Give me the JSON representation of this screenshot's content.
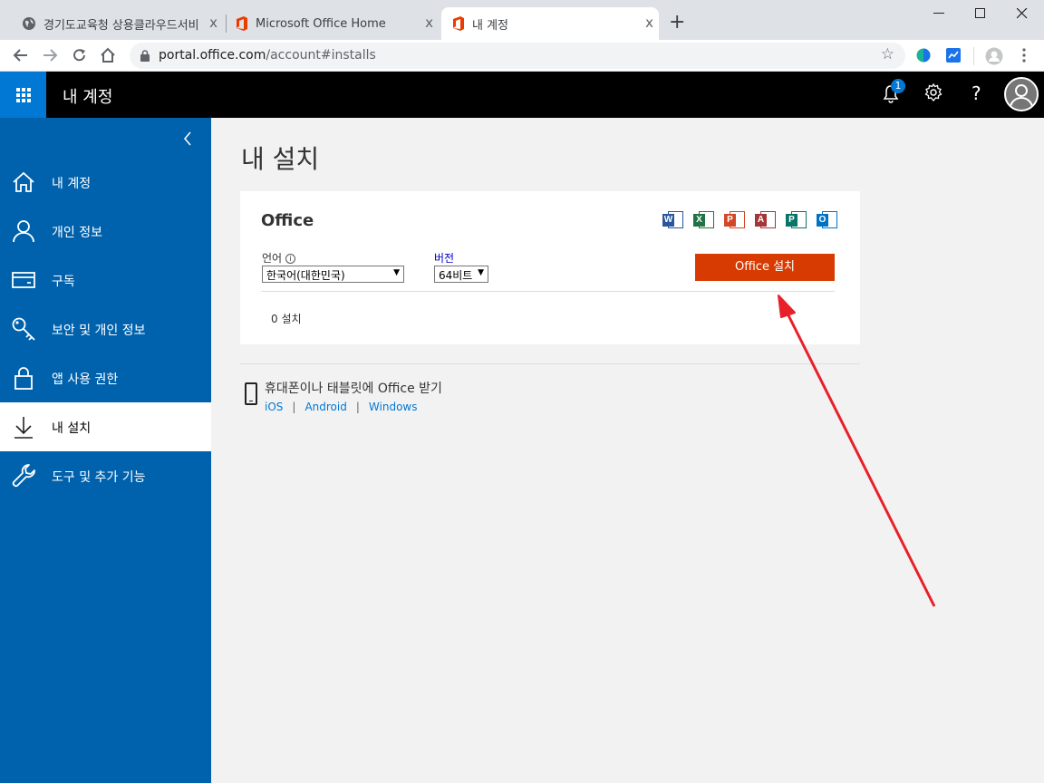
{
  "browser": {
    "tabs": [
      {
        "title": "경기도교육청 상용클라우드서비",
        "icon": "globe-icon"
      },
      {
        "title": "Microsoft Office Home",
        "icon": "office-icon"
      },
      {
        "title": "내 계정",
        "icon": "office-icon"
      }
    ],
    "url": {
      "host": "portal.office.com",
      "path": "/account#installs"
    },
    "tab_close": "x",
    "new_tab": "+"
  },
  "header": {
    "app_title": "내 계정",
    "notification_count": "1",
    "help": "?"
  },
  "sidebar": {
    "items": [
      {
        "label": "내 계정",
        "icon": "home-icon"
      },
      {
        "label": "개인 정보",
        "icon": "person-icon"
      },
      {
        "label": "구독",
        "icon": "card-icon"
      },
      {
        "label": "보안 및 개인 정보",
        "icon": "key-icon"
      },
      {
        "label": "앱 사용 권한",
        "icon": "lock-icon"
      },
      {
        "label": "내 설치",
        "icon": "download-icon",
        "active": true
      },
      {
        "label": "도구 및 추가 기능",
        "icon": "wrench-icon"
      }
    ]
  },
  "main": {
    "title": "내 설치",
    "card": {
      "product": "Office",
      "apps": [
        {
          "letter": "W",
          "color": "#2b579a"
        },
        {
          "letter": "X",
          "color": "#217346"
        },
        {
          "letter": "P",
          "color": "#d24726"
        },
        {
          "letter": "A",
          "color": "#a4373a"
        },
        {
          "letter": "P",
          "color": "#077568"
        },
        {
          "letter": "O",
          "color": "#0072c6"
        }
      ],
      "language_label": "언어",
      "language_value": "한국어(대한민국)",
      "version_label": "버전",
      "version_value": "64비트",
      "install_button": "Office 설치",
      "install_count": "0 설치"
    },
    "mobile": {
      "title": "휴대폰이나 태블릿에 Office 받기",
      "links": [
        "iOS",
        "Android",
        "Windows"
      ],
      "separator": "|"
    }
  },
  "colors": {
    "sidebar": "#0062ad",
    "accent": "#0078d4",
    "install_button": "#d83b01",
    "annotation_arrow": "#e8202a"
  }
}
